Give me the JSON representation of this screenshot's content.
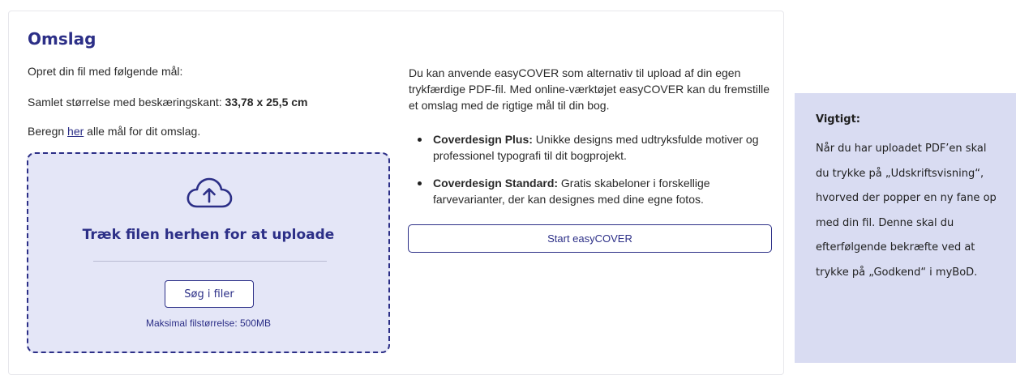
{
  "cover": {
    "title": "Omslag",
    "instruction": "Opret din fil med følgende mål:",
    "size_label": "Samlet størrelse med beskæringskant: ",
    "size_value": "33,78 x 25,5 cm",
    "calc_prefix": "Beregn ",
    "calc_link": "her",
    "calc_suffix": " alle mål for dit omslag."
  },
  "upload": {
    "icon": "cloud-upload-icon",
    "drop_text": "Træk filen herhen for at uploade",
    "browse_label": "Søg i filer",
    "max_size": "Maksimal filstørrelse: 500MB"
  },
  "easycover": {
    "intro": "Du kan anvende easyCOVER som alternativ til upload af din egen trykfærdige PDF-fil. Med online-værktøjet easyCOVER kan du fremstille et omslag med de rigtige mål til din bog.",
    "bullets": [
      {
        "title": "Coverdesign Plus:",
        "text": " Unikke designs med udtryksfulde motiver og professionel typografi til dit bogprojekt."
      },
      {
        "title": "Coverdesign Standard:",
        "text": " Gratis skabeloner i forskellige farvevarianter, der kan designes med dine egne fotos."
      }
    ],
    "button_label": "Start easyCOVER"
  },
  "notice": {
    "title": "Vigtigt:",
    "text": "Når du har uploadet PDF’en skal du trykke på „Udskriftsvisning“, hvorved der popper en ny fane op med din fil. Denne skal du efterfølgende bekræfte ved at trykke på „Godkend“ i myBoD."
  },
  "colors": {
    "accent": "#2c2f87",
    "dropzone_bg": "#e4e6f7",
    "notice_bg": "#d9dcf2"
  }
}
